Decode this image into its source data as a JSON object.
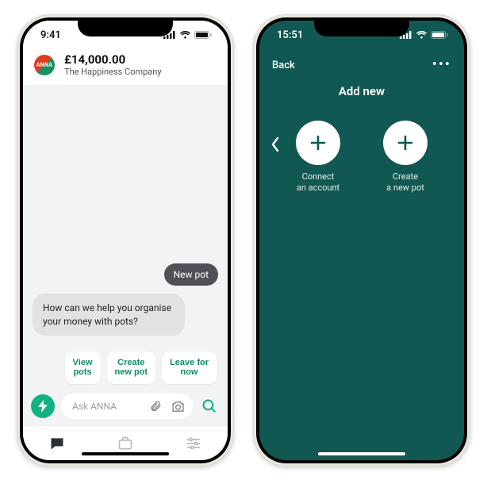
{
  "phone1": {
    "status_time": "9:41",
    "logo_text": "ANNA",
    "header": {
      "amount": "£14,000.00",
      "company": "The Happiness Company"
    },
    "user_message": "New pot",
    "bot_message": "How can we help you organise your money with pots?",
    "quick_replies": [
      "View\npots",
      "Create\nnew pot",
      "Leave for\nnow"
    ],
    "ask_placeholder": "Ask ANNA"
  },
  "phone2": {
    "status_time": "15:51",
    "nav_back": "Back",
    "nav_title": "Add new",
    "options": [
      {
        "label": "Connect\nan account"
      },
      {
        "label": "Create\na new pot"
      }
    ]
  },
  "colors": {
    "teal_dark": "#115752",
    "anna_green": "#11b184"
  }
}
